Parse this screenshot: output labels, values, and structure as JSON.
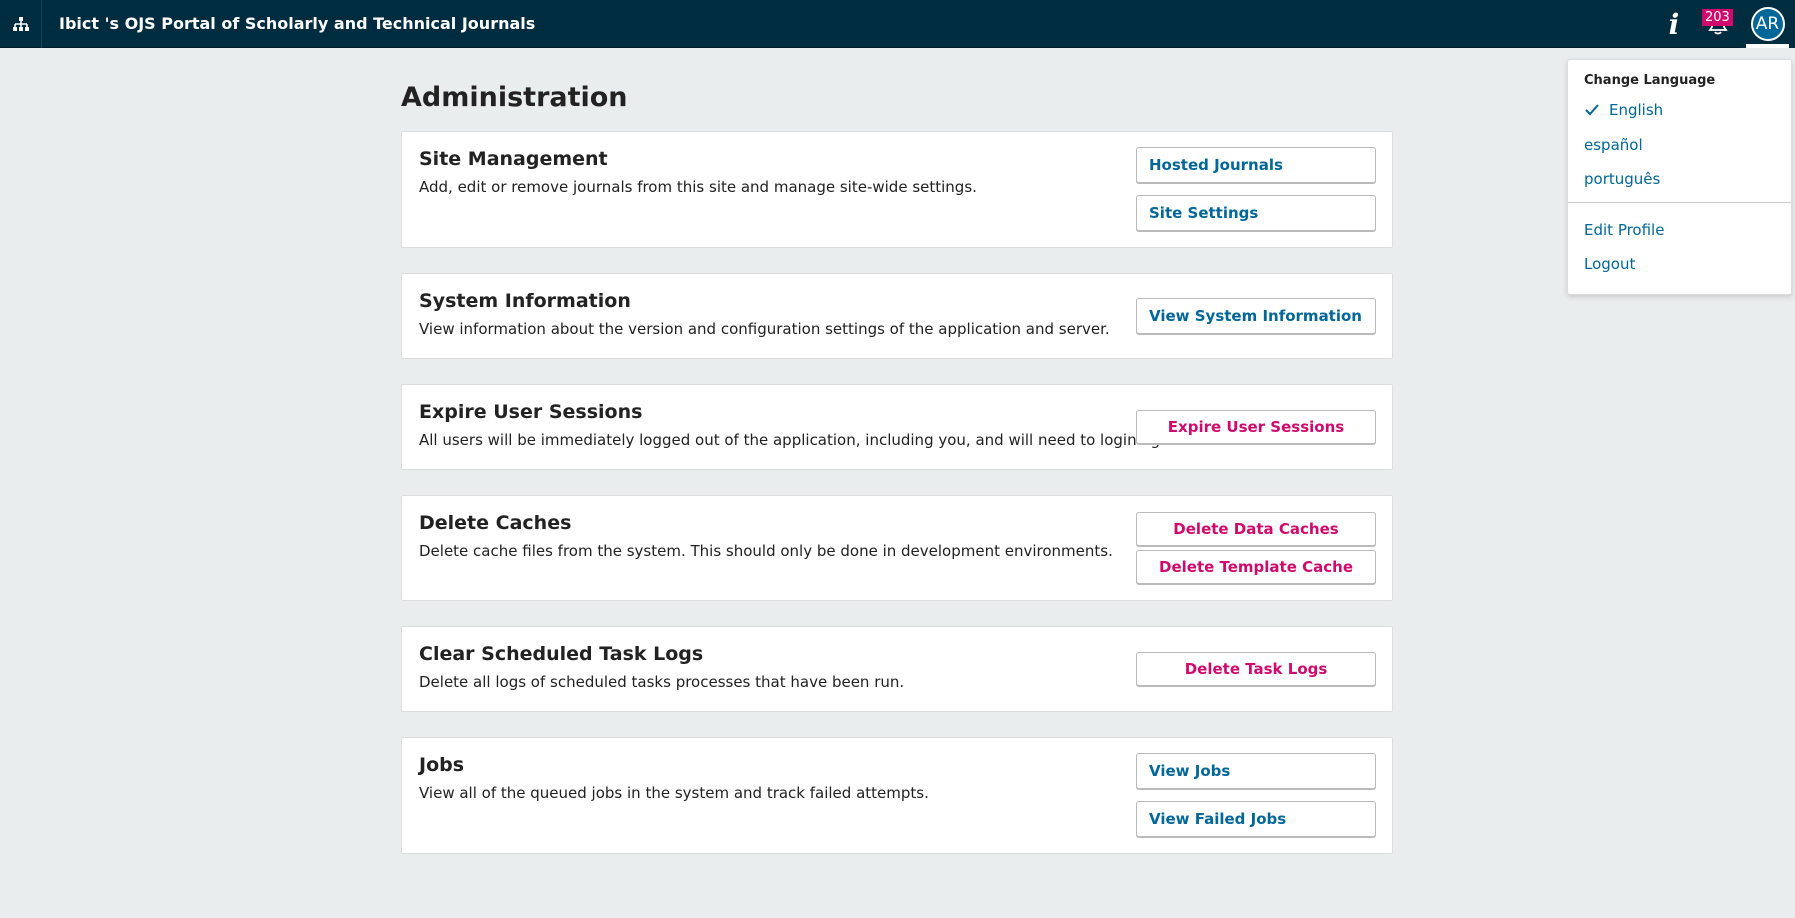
{
  "header": {
    "site_title": "Ibict 's OJS Portal of Scholarly and Technical Journals",
    "notification_count": "203",
    "avatar_initials": "AR",
    "info_icon": "info-icon",
    "bell_icon": "bell-icon",
    "sitemap_icon": "sitemap-icon"
  },
  "page": {
    "title": "Administration"
  },
  "sections": {
    "site_management": {
      "title": "Site Management",
      "description": "Add, edit or remove journals from this site and manage site-wide settings.",
      "buttons": [
        "Hosted Journals",
        "Site Settings"
      ]
    },
    "system_information": {
      "title": "System Information",
      "description": "View information about the version and configuration settings of the application and server.",
      "buttons": [
        "View System Information"
      ]
    },
    "expire_sessions": {
      "title": "Expire User Sessions",
      "description": "All users will be immediately logged out of the application, including you, and will need to login again.",
      "buttons": [
        "Expire User Sessions"
      ]
    },
    "delete_caches": {
      "title": "Delete Caches",
      "description": "Delete cache files from the system. This should only be done in development environments.",
      "buttons": [
        "Delete Data Caches",
        "Delete Template Cache"
      ]
    },
    "clear_task_logs": {
      "title": "Clear Scheduled Task Logs",
      "description": "Delete all logs of scheduled tasks processes that have been run.",
      "buttons": [
        "Delete Task Logs"
      ]
    },
    "jobs": {
      "title": "Jobs",
      "description": "View all of the queued jobs in the system and track failed attempts.",
      "buttons": [
        "View Jobs",
        "View Failed Jobs"
      ]
    }
  },
  "user_menu": {
    "change_language_label": "Change Language",
    "languages": [
      "English",
      "español",
      "português"
    ],
    "selected_language": "English",
    "edit_profile": "Edit Profile",
    "logout": "Logout"
  },
  "colors": {
    "header_bg": "#002c40",
    "link": "#006798",
    "danger": "#d00a6c",
    "page_bg": "#eaedee"
  }
}
